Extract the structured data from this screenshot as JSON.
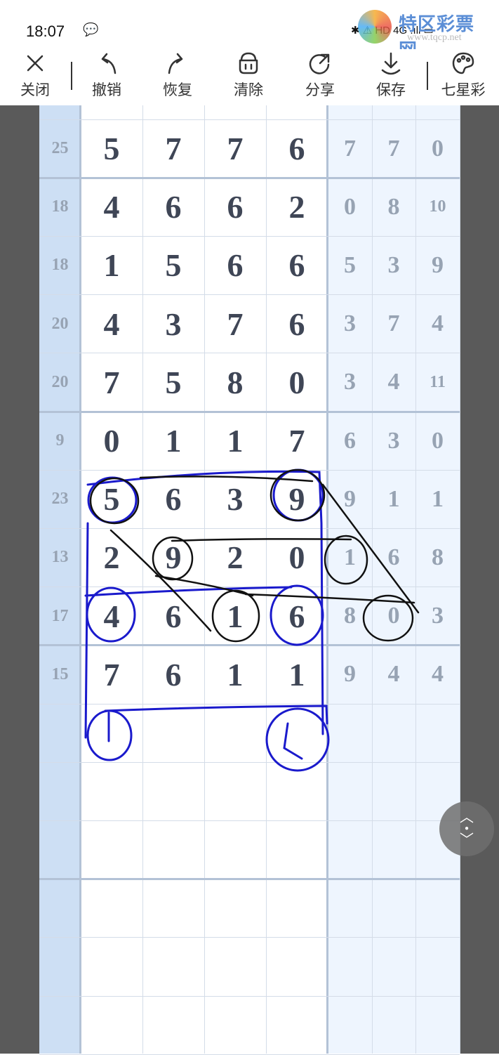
{
  "status": {
    "time": "18:07",
    "icons": "✱ ⚠ HD 4G .ıll ▭"
  },
  "watermark": {
    "title": "特区彩票网",
    "url": "www.tqcp.net"
  },
  "toolbar": [
    {
      "label": "关闭",
      "icon": "close-icon"
    },
    {
      "label": "撤销",
      "icon": "undo-icon"
    },
    {
      "label": "恢复",
      "icon": "redo-icon"
    },
    {
      "label": "清除",
      "icon": "trash-icon"
    },
    {
      "label": "分享",
      "icon": "share-icon"
    },
    {
      "label": "保存",
      "icon": "download-icon"
    },
    {
      "label": "七星彩",
      "icon": "palette-icon"
    }
  ],
  "rows": [
    {
      "sum": "25",
      "main": [
        "5",
        "7",
        "7",
        "6"
      ],
      "extra": [
        "7",
        "7",
        "0"
      ]
    },
    {
      "sum": "18",
      "main": [
        "4",
        "6",
        "6",
        "2"
      ],
      "extra": [
        "0",
        "8",
        "10"
      ]
    },
    {
      "sum": "18",
      "main": [
        "1",
        "5",
        "6",
        "6"
      ],
      "extra": [
        "5",
        "3",
        "9"
      ]
    },
    {
      "sum": "20",
      "main": [
        "4",
        "3",
        "7",
        "6"
      ],
      "extra": [
        "3",
        "7",
        "4"
      ]
    },
    {
      "sum": "20",
      "main": [
        "7",
        "5",
        "8",
        "0"
      ],
      "extra": [
        "3",
        "4",
        "11"
      ]
    },
    {
      "sum": "9",
      "main": [
        "0",
        "1",
        "1",
        "7"
      ],
      "extra": [
        "6",
        "3",
        "0"
      ]
    },
    {
      "sum": "23",
      "main": [
        "5",
        "6",
        "3",
        "9"
      ],
      "extra": [
        "9",
        "1",
        "1"
      ]
    },
    {
      "sum": "13",
      "main": [
        "2",
        "9",
        "2",
        "0"
      ],
      "extra": [
        "1",
        "6",
        "8"
      ]
    },
    {
      "sum": "17",
      "main": [
        "4",
        "6",
        "1",
        "6"
      ],
      "extra": [
        "8",
        "0",
        "3"
      ]
    },
    {
      "sum": "15",
      "main": [
        "7",
        "6",
        "1",
        "1"
      ],
      "extra": [
        "9",
        "4",
        "4"
      ]
    }
  ],
  "colors": {
    "sum_col": "#cddff4",
    "extra_col": "#eef5fe",
    "main_text": "#3f4656",
    "dim_text": "#97a3b3",
    "ink_blue": "#1a1acc",
    "ink_black": "#111111"
  },
  "fab": {
    "icon": "scroll-toggle-icon"
  }
}
